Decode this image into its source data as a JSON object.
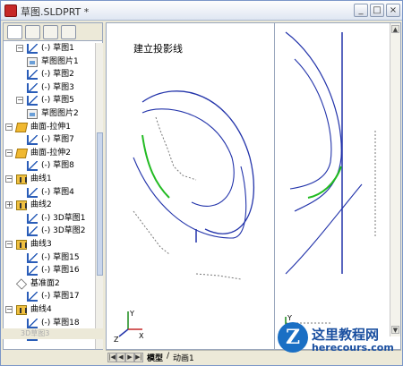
{
  "window": {
    "title": "草图.SLDPRT *",
    "buttons": {
      "minimize": "_",
      "maximize": "□",
      "close": "×"
    }
  },
  "feature_tree": {
    "items": [
      {
        "label": "(-) 草图1",
        "icon": "sketch-icon",
        "expand": "−"
      },
      {
        "label": "草图图片1",
        "icon": "picture-icon",
        "expand": ""
      },
      {
        "label": "(-) 草图2",
        "icon": "sketch-icon",
        "expand": ""
      },
      {
        "label": "(-) 草图3",
        "icon": "sketch-icon",
        "expand": ""
      },
      {
        "label": "(-) 草图5",
        "icon": "sketch-icon",
        "expand": "−"
      },
      {
        "label": "草图图片2",
        "icon": "picture-icon",
        "expand": ""
      },
      {
        "label": "曲面-拉伸1",
        "icon": "extrude-surface-icon",
        "expand": "−"
      },
      {
        "label": "(-) 草图7",
        "icon": "sketch-icon",
        "expand": ""
      },
      {
        "label": "曲面-拉伸2",
        "icon": "extrude-surface-icon",
        "expand": "−"
      },
      {
        "label": "(-) 草图8",
        "icon": "sketch-icon",
        "expand": ""
      },
      {
        "label": "曲线1",
        "icon": "curve-icon",
        "expand": "−"
      },
      {
        "label": "(-) 草图4",
        "icon": "sketch-icon",
        "expand": ""
      },
      {
        "label": "曲线2",
        "icon": "curve-icon",
        "expand": "+"
      },
      {
        "label": "(-) 3D草图1",
        "icon": "sketch-icon",
        "expand": ""
      },
      {
        "label": "(-) 3D草图2",
        "icon": "sketch-icon",
        "expand": ""
      },
      {
        "label": "曲线3",
        "icon": "curve-icon",
        "expand": "−"
      },
      {
        "label": "(-) 草图15",
        "icon": "sketch-icon",
        "expand": ""
      },
      {
        "label": "(-) 草图16",
        "icon": "sketch-icon",
        "expand": ""
      },
      {
        "label": "基准面2",
        "icon": "plane-icon",
        "expand": ""
      },
      {
        "label": "(-) 草图17",
        "icon": "sketch-icon",
        "expand": ""
      },
      {
        "label": "曲线4",
        "icon": "curve-icon",
        "expand": "−"
      },
      {
        "label": "(-) 草图18",
        "icon": "sketch-icon",
        "expand": ""
      },
      {
        "label": "(-) 草图19",
        "icon": "sketch-icon",
        "expand": ""
      }
    ],
    "footer_faded": "3D草图3"
  },
  "viewport": {
    "annotation": "建立投影线",
    "left_view_axes": [
      "X",
      "Y",
      "Z"
    ],
    "right_view_axes": [
      "X",
      "Y"
    ]
  },
  "sheet_tabs": {
    "model": "模型",
    "animation": "动画1",
    "separator": "/"
  },
  "watermark": {
    "logo_letter": "Z",
    "title": "这里教程网",
    "url": "herecours.com"
  },
  "colors": {
    "curve_blue": "#2233aa",
    "curve_green": "#22bb22",
    "projection_gray": "#777777",
    "selected_row": "#d8dfee"
  }
}
